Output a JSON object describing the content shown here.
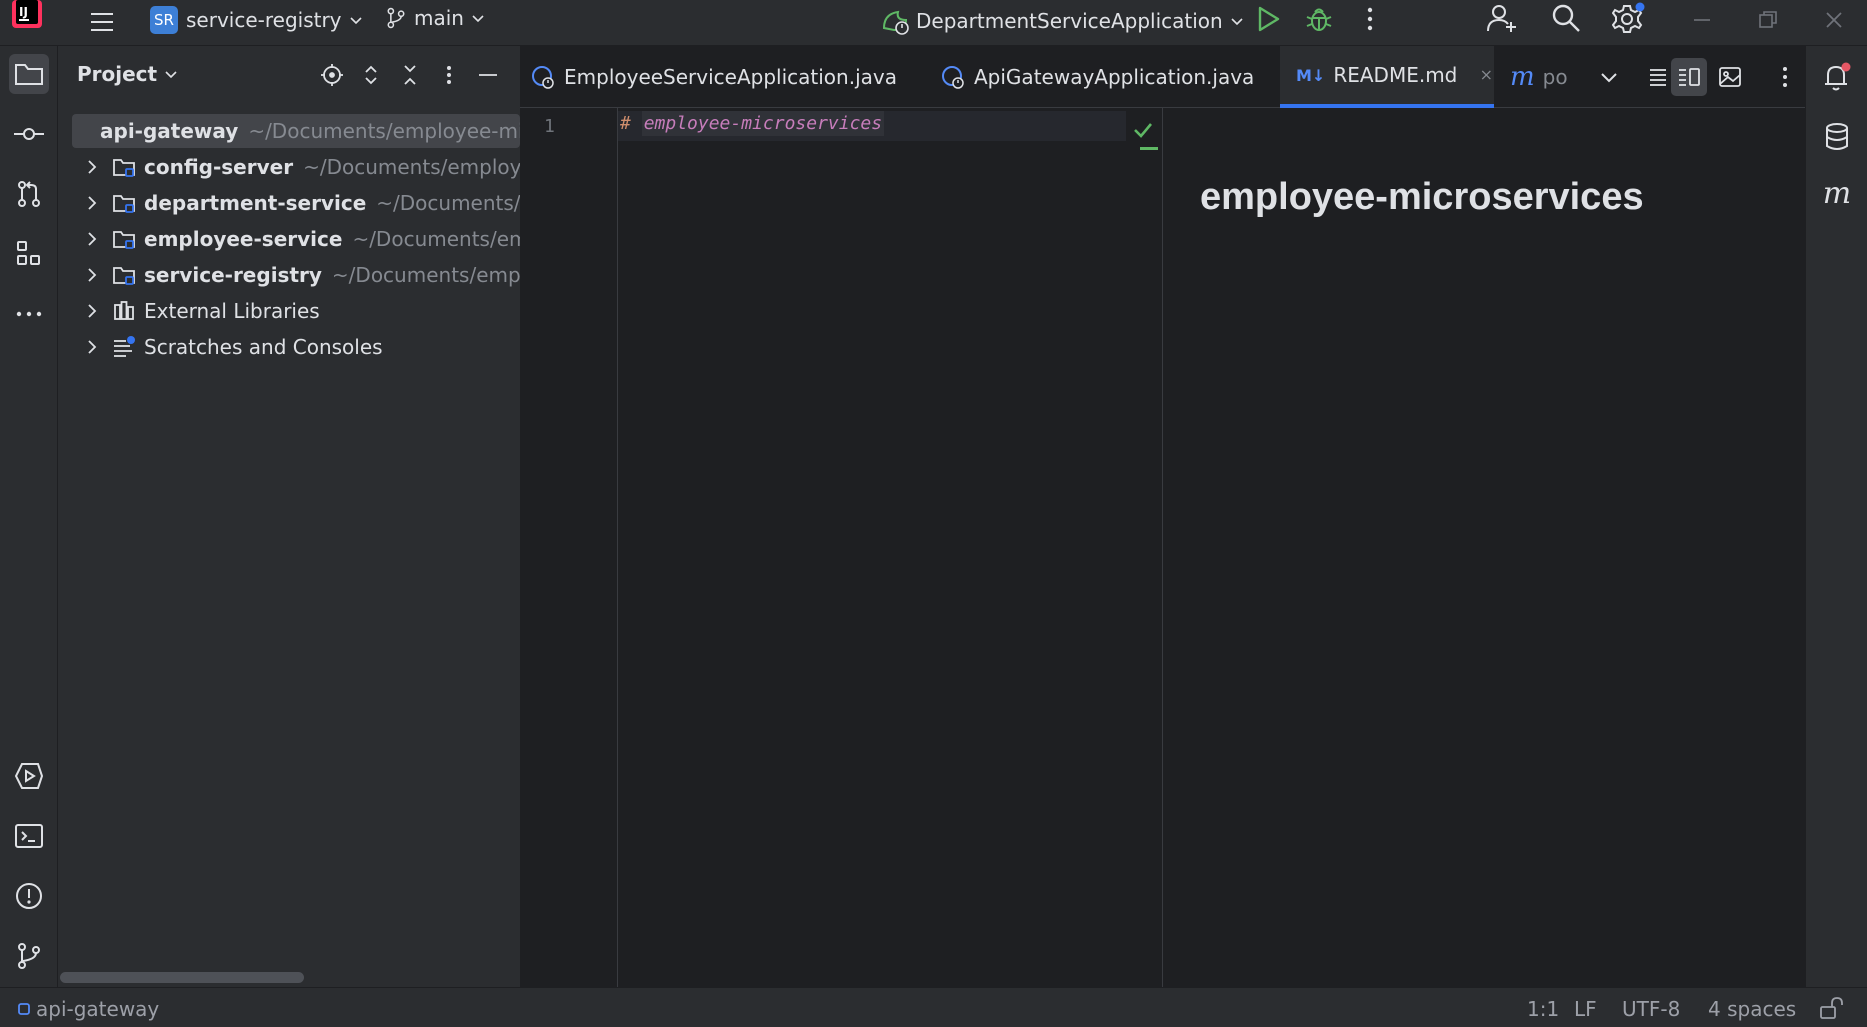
{
  "titlebar": {
    "project_badge": "SR",
    "project_name": "service-registry",
    "branch": "main",
    "run_config": "DepartmentServiceApplication"
  },
  "project_panel": {
    "title": "Project",
    "items": [
      {
        "name": "api-gateway",
        "path": "~/Documents/employee-microservices/api-gateway"
      },
      {
        "name": "config-server",
        "path": "~/Documents/employee-microservices/config-server"
      },
      {
        "name": "department-service",
        "path": "~/Documents/employee-microservices/department-service"
      },
      {
        "name": "employee-service",
        "path": "~/Documents/employee-microservices/employee-service"
      },
      {
        "name": "service-registry",
        "path": "~/Documents/employee-microservices/service-registry"
      },
      {
        "name": "External Libraries"
      },
      {
        "name": "Scratches and Consoles"
      }
    ]
  },
  "tabs": [
    {
      "label": "EmployeeServiceApplication.java"
    },
    {
      "label": "ApiGatewayApplication.java"
    },
    {
      "label": "README.md",
      "badge": "M↓"
    },
    {
      "label": "po"
    }
  ],
  "editor": {
    "line_number": "1",
    "hash": "#",
    "heading_text": "employee-microservices"
  },
  "preview": {
    "heading": "employee-microservices"
  },
  "statusbar": {
    "module": "api-gateway",
    "position": "1:1",
    "line_sep": "LF",
    "encoding": "UTF-8",
    "indent": "4 spaces"
  },
  "colors": {
    "accent": "#3574f0",
    "run_green": "#5fb865",
    "debug_green": "#5fb865",
    "markdown_heading": "#c77dbb",
    "markdown_hash": "#cf8e6d"
  }
}
